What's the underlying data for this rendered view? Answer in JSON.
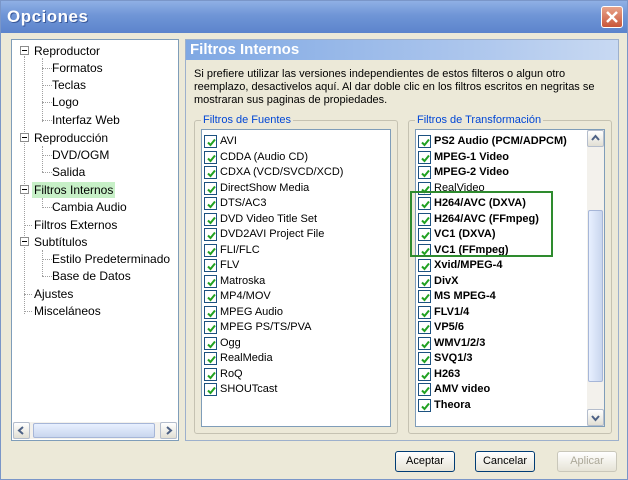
{
  "window": {
    "title": "Opciones"
  },
  "tree": {
    "items": [
      {
        "label": "Reproductor"
      },
      {
        "label": "Formatos"
      },
      {
        "label": "Teclas"
      },
      {
        "label": "Logo"
      },
      {
        "label": "Interfaz Web"
      },
      {
        "label": "Reproducción"
      },
      {
        "label": "DVD/OGM"
      },
      {
        "label": "Salida"
      },
      {
        "label": "Filtros Internos"
      },
      {
        "label": "Cambia Audio"
      },
      {
        "label": "Filtros Externos"
      },
      {
        "label": "Subtítulos"
      },
      {
        "label": "Estilo Predeterminado"
      },
      {
        "label": "Base de Datos"
      },
      {
        "label": "Ajustes"
      },
      {
        "label": "Misceláneos"
      }
    ]
  },
  "panel": {
    "title": "Filtros Internos",
    "description": "Si prefiere utilizar las versiones independientes de estos filteros o algun otro reemplazo, desactivelos aquí. Al dar doble clic en los filtros escritos en negritas se mostraran sus paginas de propiedades."
  },
  "source_filters": {
    "title": "Filtros de Fuentes",
    "items": [
      {
        "label": "AVI"
      },
      {
        "label": "CDDA (Audio CD)"
      },
      {
        "label": "CDXA (VCD/SVCD/XCD)"
      },
      {
        "label": "DirectShow Media"
      },
      {
        "label": "DTS/AC3"
      },
      {
        "label": "DVD Video Title Set"
      },
      {
        "label": "DVD2AVI Project File"
      },
      {
        "label": "FLI/FLC"
      },
      {
        "label": "FLV"
      },
      {
        "label": "Matroska"
      },
      {
        "label": "MP4/MOV"
      },
      {
        "label": "MPEG Audio"
      },
      {
        "label": "MPEG PS/TS/PVA"
      },
      {
        "label": "Ogg"
      },
      {
        "label": "RealMedia"
      },
      {
        "label": "RoQ"
      },
      {
        "label": "SHOUTcast"
      }
    ]
  },
  "transform_filters": {
    "title": "Filtros de Transformación",
    "items": [
      {
        "label": "PS2 Audio (PCM/ADPCM)",
        "bold": true
      },
      {
        "label": "MPEG-1 Video",
        "bold": true
      },
      {
        "label": "MPEG-2 Video",
        "bold": true
      },
      {
        "label": "RealVideo",
        "bold": false
      },
      {
        "label": "H264/AVC (DXVA)",
        "bold": true
      },
      {
        "label": "H264/AVC (FFmpeg)",
        "bold": true
      },
      {
        "label": "VC1 (DXVA)",
        "bold": true
      },
      {
        "label": "VC1 (FFmpeg)",
        "bold": true
      },
      {
        "label": "Xvid/MPEG-4",
        "bold": true
      },
      {
        "label": "DivX",
        "bold": true
      },
      {
        "label": "MS MPEG-4",
        "bold": true
      },
      {
        "label": "FLV1/4",
        "bold": true
      },
      {
        "label": "VP5/6",
        "bold": true
      },
      {
        "label": "WMV1/2/3",
        "bold": true
      },
      {
        "label": "SVQ1/3",
        "bold": true
      },
      {
        "label": "H263",
        "bold": true
      },
      {
        "label": "AMV video",
        "bold": true
      },
      {
        "label": "Theora",
        "bold": true
      }
    ]
  },
  "buttons": {
    "accept": "Aceptar",
    "cancel": "Cancelar",
    "apply": "Aplicar"
  },
  "colors": {
    "accent": "#2E8B2E",
    "selection": "#C7F0C7",
    "group_title": "#0046D5"
  }
}
